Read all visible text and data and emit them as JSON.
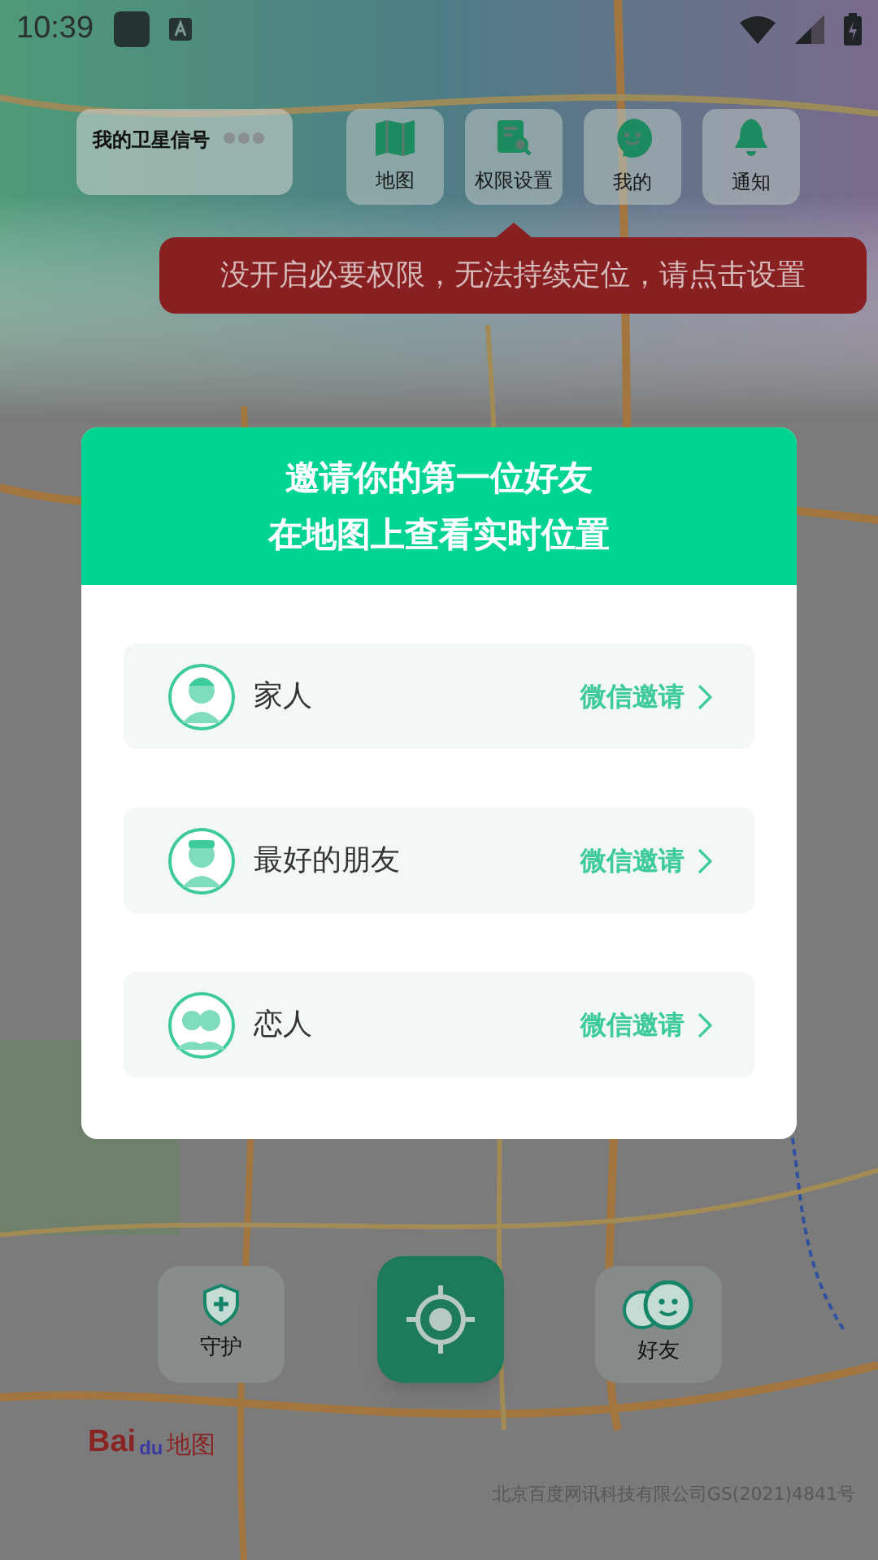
{
  "status_bar": {
    "time": "10:39"
  },
  "satellite_card": {
    "title": "我的卫星信号"
  },
  "top_nav": [
    {
      "label": "地图"
    },
    {
      "label": "权限设置"
    },
    {
      "label": "我的"
    },
    {
      "label": "通知"
    }
  ],
  "tooltip": {
    "text": "没开启必要权限，无法持续定位，请点击设置"
  },
  "dialog": {
    "title_lines": [
      "邀请你的第一位好友",
      "在地图上查看实时位置"
    ],
    "rows": [
      {
        "name": "家人",
        "action": "微信邀请"
      },
      {
        "name": "最好的朋友",
        "action": "微信邀请"
      },
      {
        "name": "恋人",
        "action": "微信邀请"
      }
    ]
  },
  "bottom_bar": {
    "left_label": "守护",
    "right_label": "好友"
  },
  "map": {
    "logo": [
      "Bai",
      "du",
      "地图"
    ],
    "copyright": "北京百度网讯科技有限公司GS(2021)4841号"
  }
}
